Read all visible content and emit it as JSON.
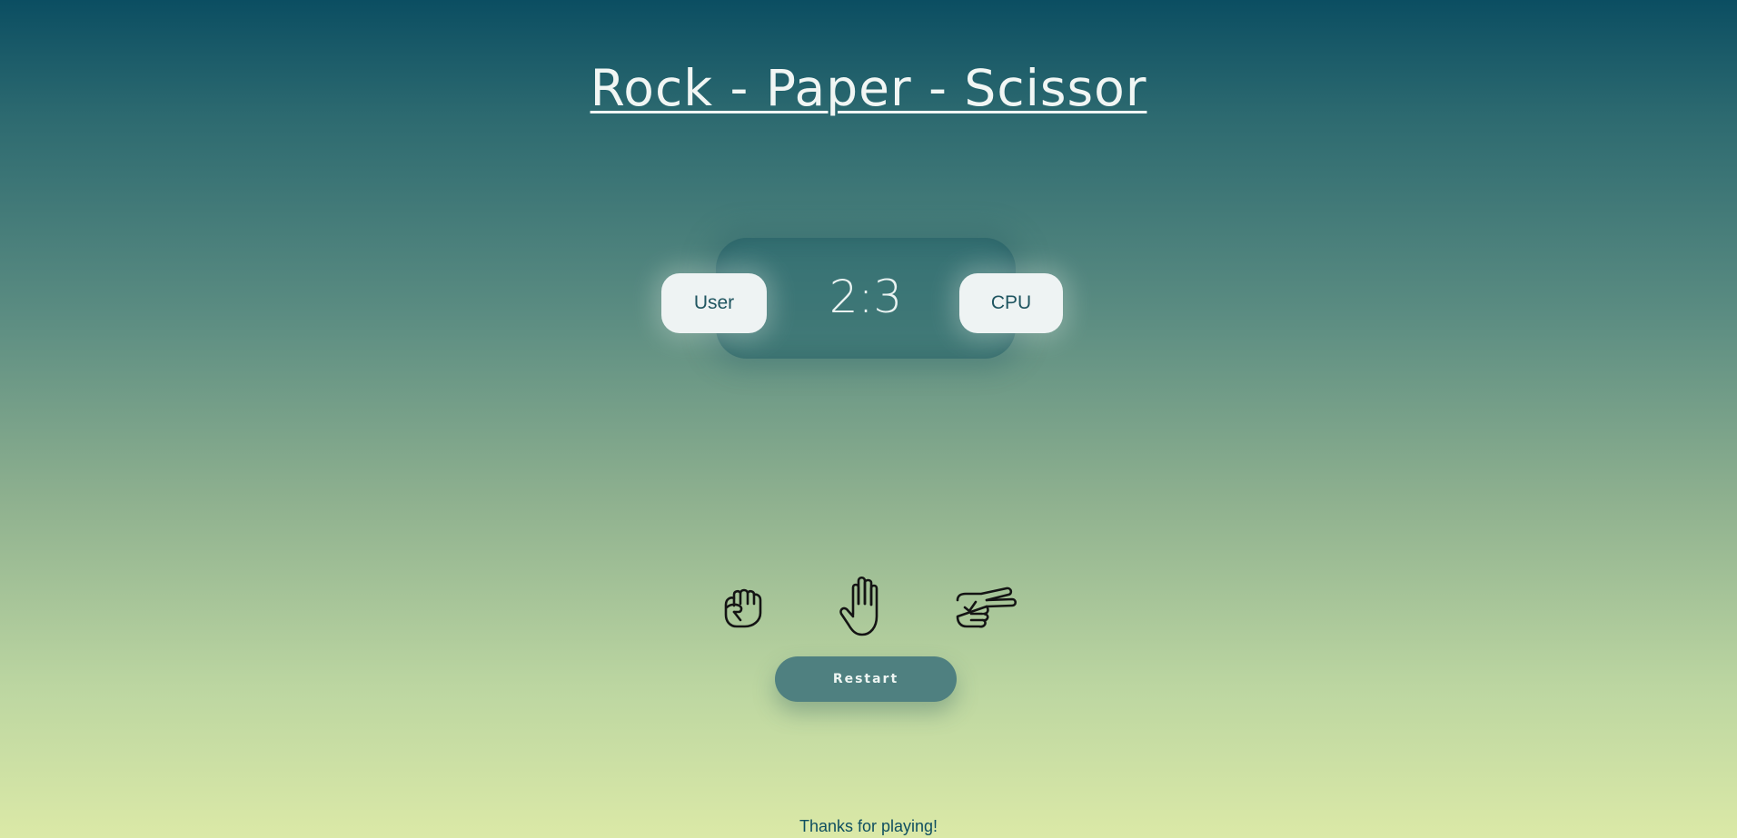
{
  "header": {
    "title": "Rock - Paper - Scissor"
  },
  "scoreboard": {
    "user_label": "User",
    "cpu_label": "CPU",
    "score": "2:3"
  },
  "choices": [
    {
      "name": "rock",
      "icon": "fist-icon"
    },
    {
      "name": "paper",
      "icon": "open-hand-icon"
    },
    {
      "name": "scissor",
      "icon": "peace-hand-icon"
    }
  ],
  "controls": {
    "restart_label": "Restart"
  },
  "footer": {
    "text": "Thanks for playing!"
  },
  "colors": {
    "background_top": "#0b4e62",
    "background_bottom": "#dbe9a7",
    "chip_background": "#eef3f3",
    "restart_button": "#4f8080",
    "footer_text": "#0f4f60"
  }
}
